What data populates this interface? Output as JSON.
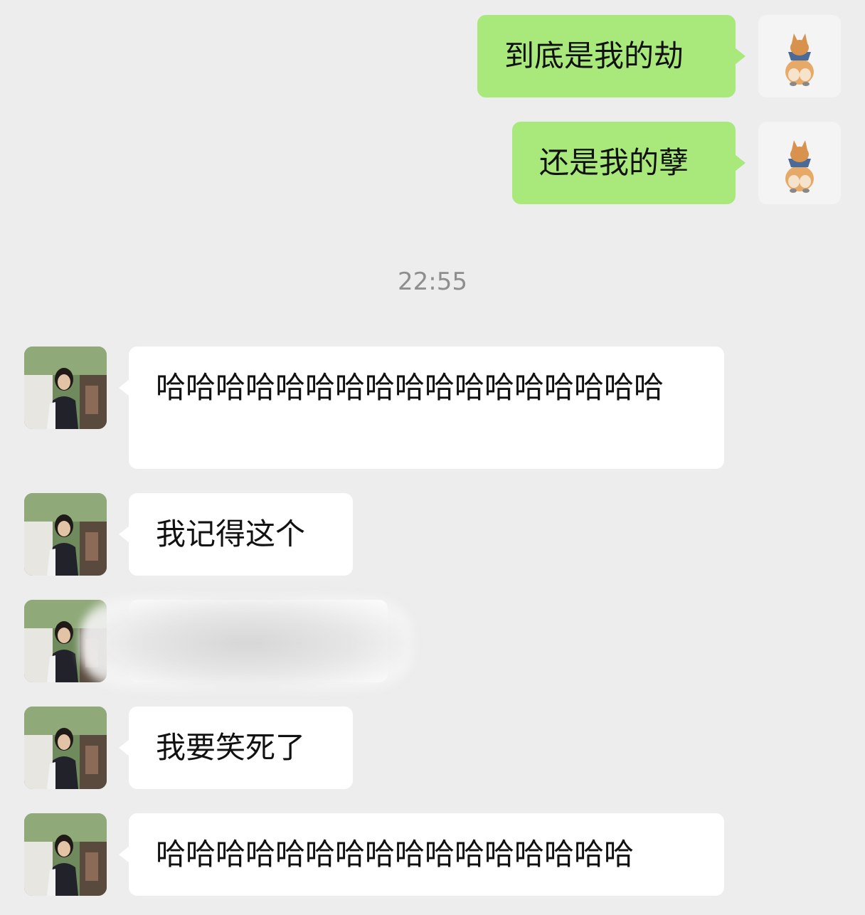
{
  "outgoing": [
    {
      "text": "到底是我的劫",
      "avatar_icon": "corgi-avatar-icon"
    },
    {
      "text": "还是我的孽",
      "avatar_icon": "corgi-avatar-icon"
    }
  ],
  "timestamp": "22:55",
  "incoming": [
    {
      "text": "哈哈哈哈哈哈哈哈哈哈哈哈哈哈哈哈哈",
      "avatar_icon": "person-photo-avatar-icon"
    },
    {
      "text": "我记得这个",
      "avatar_icon": "person-photo-avatar-icon"
    },
    {
      "text": "",
      "avatar_icon": "person-photo-avatar-icon",
      "redacted": true
    },
    {
      "text": "我要笑死了",
      "avatar_icon": "person-photo-avatar-icon"
    },
    {
      "text": "哈哈哈哈哈哈哈哈哈哈哈哈哈哈哈哈",
      "avatar_icon": "person-photo-avatar-icon"
    }
  ],
  "colors": {
    "background": "#ededed",
    "outgoing_bubble": "#a9e97b",
    "incoming_bubble": "#ffffff",
    "timestamp_text": "#8e8e8e"
  }
}
